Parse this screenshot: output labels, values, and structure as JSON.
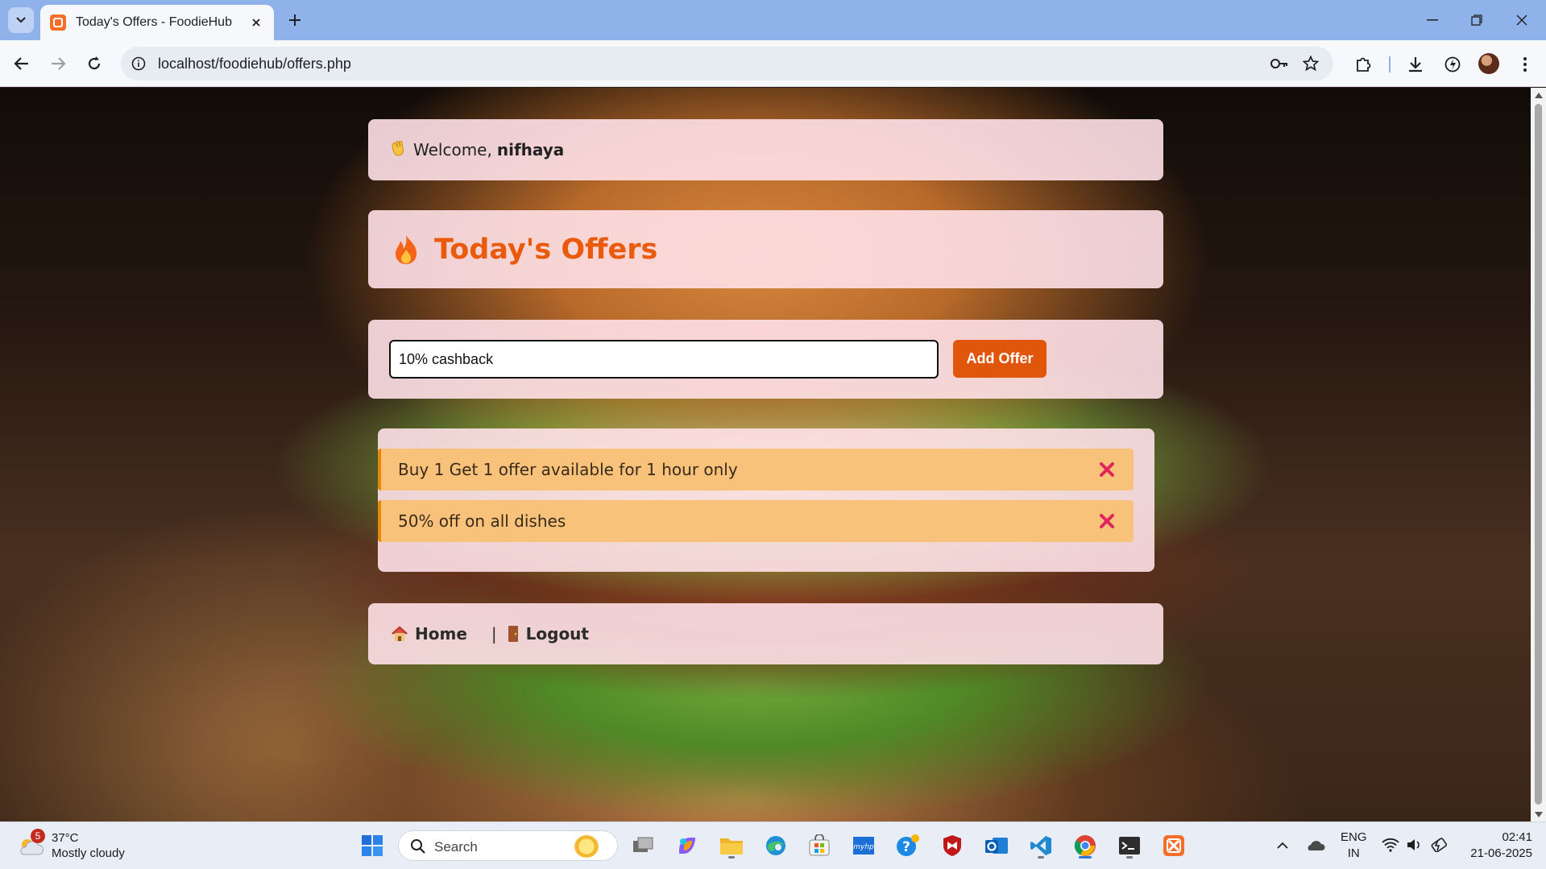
{
  "browser": {
    "tab_title": "Today's Offers - FoodieHub",
    "url": "localhost/foodiehub/offers.php"
  },
  "page": {
    "welcome_prefix": "Welcome,",
    "username": "nifhaya",
    "title": "Today's Offers",
    "offer_input_value": "10% cashback",
    "add_button_label": "Add Offer",
    "offers": [
      {
        "text": "Buy 1 Get 1 offer available for 1 hour only"
      },
      {
        "text": "50% off on all dishes"
      }
    ],
    "nav": {
      "home_label": "Home",
      "separator": "|",
      "logout_label": "Logout"
    }
  },
  "taskbar": {
    "weather_badge": "5",
    "weather_temp": "37°C",
    "weather_desc": "Mostly cloudy",
    "search_label": "Search",
    "lang_line1": "ENG",
    "lang_line2": "IN",
    "time": "02:41",
    "date": "21-06-2025"
  },
  "colors": {
    "accent": "#e0560a",
    "title": "#ea5a0c",
    "offer_bg": "#f8c27a",
    "card_bg": "#ffe1e8",
    "delete_icon": "#e0245e"
  }
}
